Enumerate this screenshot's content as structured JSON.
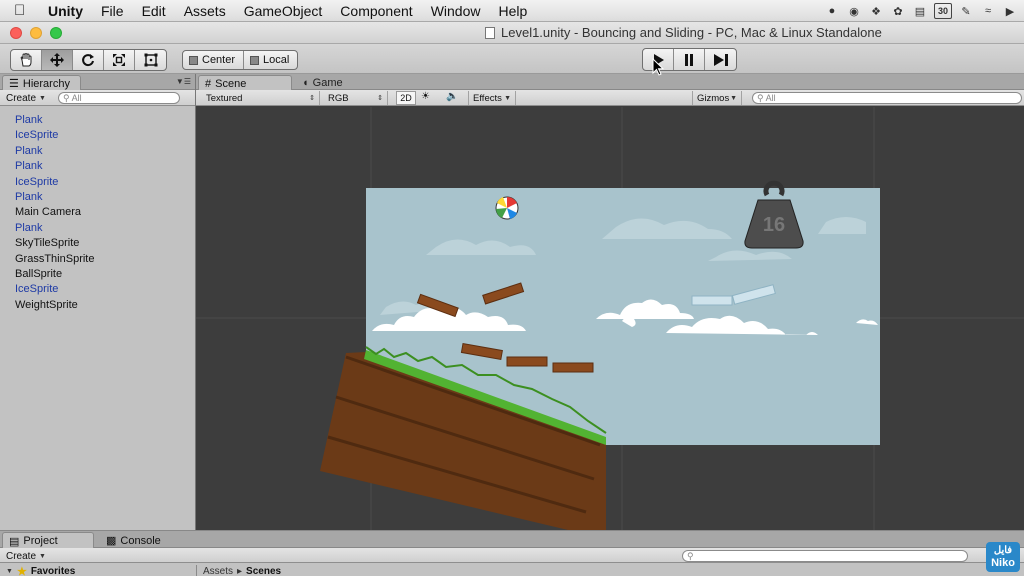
{
  "menubar": {
    "app_name": "Unity",
    "items": [
      "File",
      "Edit",
      "Assets",
      "GameObject",
      "Component",
      "Window",
      "Help"
    ],
    "tray": {
      "calendar_day": "30"
    }
  },
  "window": {
    "title": "Level1.unity - Bouncing and Sliding - PC, Mac & Linux Standalone"
  },
  "toolbar": {
    "tools": [
      {
        "name": "hand-tool",
        "icon": "hand-icon"
      },
      {
        "name": "move-tool",
        "icon": "move-arrows-icon"
      },
      {
        "name": "rotate-tool",
        "icon": "rotate-icon"
      },
      {
        "name": "scale-tool",
        "icon": "scale-icon"
      },
      {
        "name": "rect-tool",
        "icon": "rect-transform-icon"
      }
    ],
    "pivot_label": "Center",
    "space_label": "Local",
    "play": {
      "play": "play-icon",
      "pause": "pause-icon",
      "step": "step-icon"
    }
  },
  "hierarchy": {
    "tab_label": "Hierarchy",
    "create_label": "Create",
    "search_placeholder": "All",
    "items": [
      {
        "label": "Plank",
        "prefab": true
      },
      {
        "label": "IceSprite",
        "prefab": true
      },
      {
        "label": "Plank",
        "prefab": true
      },
      {
        "label": "Plank",
        "prefab": true
      },
      {
        "label": "IceSprite",
        "prefab": true
      },
      {
        "label": "Plank",
        "prefab": true
      },
      {
        "label": "Main Camera",
        "prefab": false
      },
      {
        "label": "Plank",
        "prefab": true
      },
      {
        "label": "SkyTileSprite",
        "prefab": false
      },
      {
        "label": "GrassThinSprite",
        "prefab": false
      },
      {
        "label": "BallSprite",
        "prefab": false
      },
      {
        "label": "IceSprite",
        "prefab": true
      },
      {
        "label": "WeightSprite",
        "prefab": false
      }
    ]
  },
  "scene": {
    "scene_tab": "Scene",
    "game_tab": "Game",
    "render_mode": "Textured",
    "color_mode": "RGB",
    "mode_2d": "2D",
    "effects_label": "Effects",
    "gizmos_label": "Gizmos",
    "search_placeholder": "All",
    "weight_label": "16"
  },
  "bottom": {
    "project_tab": "Project",
    "console_tab": "Console",
    "create_label": "Create",
    "favorites_label": "Favorites",
    "breadcrumb": [
      "Assets",
      "Scenes"
    ]
  },
  "watermark": {
    "line1": "فایل",
    "line2": "Niko"
  },
  "colors": {
    "prefab_text": "#1e3aa5",
    "sky": "#a8c3cc",
    "viewport_bg": "#3d3d3d"
  }
}
